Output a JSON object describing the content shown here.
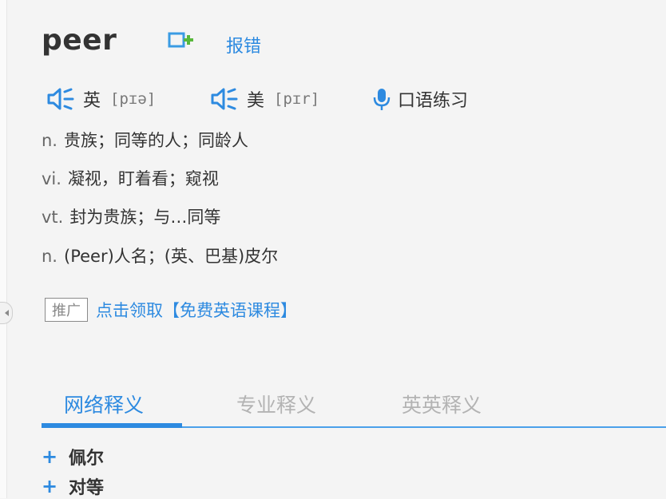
{
  "entry": {
    "word": "peer",
    "report_label": "报错"
  },
  "pronunciation": {
    "uk_label": "英",
    "uk_phonetic": "[pɪə]",
    "us_label": "美",
    "us_phonetic": "[pɪr]",
    "oral_label": "口语练习"
  },
  "definitions": [
    {
      "pos": "n.",
      "text": "贵族；同等的人；同龄人"
    },
    {
      "pos": "vi.",
      "text": "凝视，盯着看；窥视"
    },
    {
      "pos": "vt.",
      "text": "封为贵族；与…同等"
    },
    {
      "pos": "n.",
      "text": "(Peer)人名；(英、巴基)皮尔"
    }
  ],
  "promo": {
    "tag": "推广",
    "link_text": "点击领取【免费英语课程】"
  },
  "tabs": [
    {
      "label": "网络释义"
    },
    {
      "label": "专业释义"
    },
    {
      "label": "英英释义"
    }
  ],
  "web_entries": [
    {
      "plus": "+",
      "text": "佩尔"
    },
    {
      "plus": "+",
      "text": "对等"
    }
  ],
  "colors": {
    "accent": "#2d8ae0",
    "text": "#333333",
    "inactive_tab": "#b3b3b3",
    "background": "#f4f4f4"
  },
  "icons": {
    "add_wordbook": "add-to-wordbook-icon",
    "speaker": "speaker-icon",
    "microphone": "microphone-icon",
    "collapse": "collapse-arrow-icon"
  }
}
